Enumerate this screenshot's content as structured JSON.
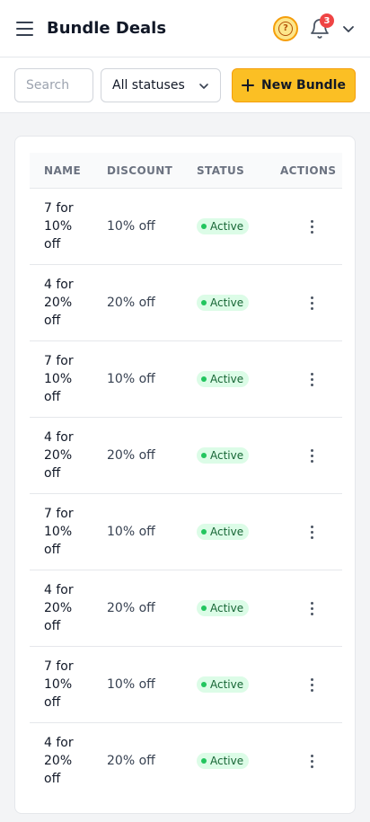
{
  "header": {
    "title": "Bundle Deals",
    "notification_count": "3",
    "icons": [
      "menu-icon",
      "help-icon",
      "bell-icon",
      "chevron-down-icon"
    ],
    "accent_color": "#f59e0b"
  },
  "toolbar": {
    "search_placeholder": "Search",
    "status_filter": "All statuses",
    "new_button_label": "New Bundle",
    "new_button_color": "#fbbf24"
  },
  "table": {
    "columns": [
      "NAME",
      "DISCOUNT",
      "STATUS",
      "ACTIONS"
    ],
    "rows": [
      {
        "name": "7 for 10% off",
        "discount": "10% off",
        "status": "Active"
      },
      {
        "name": "4 for 20% off",
        "discount": "20% off",
        "status": "Active"
      },
      {
        "name": "7 for 10% off",
        "discount": "10% off",
        "status": "Active"
      },
      {
        "name": "4 for 20% off",
        "discount": "20% off",
        "status": "Active"
      },
      {
        "name": "7 for 10% off",
        "discount": "10% off",
        "status": "Active"
      },
      {
        "name": "4 for 20% off",
        "discount": "20% off",
        "status": "Active"
      },
      {
        "name": "7 for 10% off",
        "discount": "10% off",
        "status": "Active"
      },
      {
        "name": "4 for 20% off",
        "discount": "20% off",
        "status": "Active"
      }
    ],
    "status_color": "#22c55e"
  }
}
